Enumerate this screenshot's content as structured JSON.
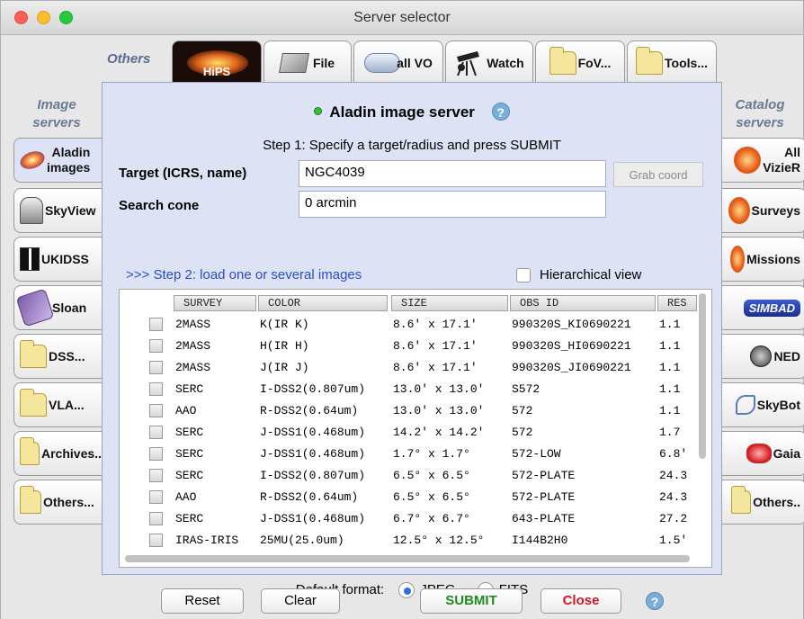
{
  "window": {
    "title": "Server selector"
  },
  "captions": {
    "top": "Others",
    "left": "Image servers",
    "right": "Catalog servers"
  },
  "top_tabs": [
    {
      "label": "HiPS",
      "icon": "hips-galaxy-icon"
    },
    {
      "label": "File",
      "icon": "disk-icon"
    },
    {
      "label": "all VO",
      "icon": "cloud-icon"
    },
    {
      "label": "Watch",
      "icon": "telescope-icon"
    },
    {
      "label": "FoV...",
      "icon": "folder-icon"
    },
    {
      "label": "Tools...",
      "icon": "folder-icon"
    }
  ],
  "left_tabs": [
    {
      "line1": "Aladin",
      "line2": "images",
      "icon": "galaxy-icon"
    },
    {
      "line1": "SkyView",
      "icon": "skyview-icon"
    },
    {
      "line1": "UKIDSS",
      "icon": "ukidss-icon"
    },
    {
      "line1": "Sloan",
      "icon": "sloan-icon"
    },
    {
      "line1": "DSS...",
      "icon": "folder-icon"
    },
    {
      "line1": "VLA...",
      "icon": "folder-icon"
    },
    {
      "line1": "Archives...",
      "icon": "folder-icon"
    },
    {
      "line1": "Others...",
      "icon": "folder-icon"
    }
  ],
  "right_tabs": [
    {
      "line1": "All",
      "line2": "VizieR",
      "icon": "vizier-icon"
    },
    {
      "line1": "Surveys",
      "icon": "surveys-icon"
    },
    {
      "line1": "Missions",
      "icon": "missions-icon"
    },
    {
      "line1": "SIMBAD",
      "icon": "simbad-logo-icon"
    },
    {
      "line1": "NED",
      "icon": "ned-logo-icon"
    },
    {
      "line1": "SkyBot",
      "icon": "skybot-icon"
    },
    {
      "line1": "Gaia",
      "icon": "gaia-icon"
    },
    {
      "line1": "Others..",
      "icon": "folder-icon"
    }
  ],
  "panel": {
    "title": "Aladin image server",
    "help": "?",
    "step1": "Step 1: Specify a target/radius and press SUBMIT",
    "target_label": "Target (ICRS, name)",
    "target_value": "NGC4039",
    "grab_label": "Grab coord",
    "cone_label": "Search cone",
    "cone_value": "0 arcmin",
    "step2": ">>> Step 2: load one or several images",
    "hierarchical_label": "Hierarchical view",
    "format_label": "Default format:",
    "format_options": [
      "JPEG",
      "FITS"
    ],
    "format_selected": "JPEG"
  },
  "table": {
    "columns": [
      "SURVEY",
      "COLOR",
      "SIZE",
      "OBS ID",
      "RES"
    ],
    "rows": [
      [
        "2MASS",
        "K(IR K)",
        "8.6' x 17.1'",
        "990320S_KI0690221",
        "1.1"
      ],
      [
        "2MASS",
        "H(IR H)",
        "8.6' x 17.1'",
        "990320S_HI0690221",
        "1.1"
      ],
      [
        "2MASS",
        "J(IR J)",
        "8.6' x 17.1'",
        "990320S_JI0690221",
        "1.1"
      ],
      [
        "SERC",
        "I-DSS2(0.807um)",
        "13.0' x 13.0'",
        "S572",
        "1.1"
      ],
      [
        "AAO",
        "R-DSS2(0.64um)",
        "13.0' x 13.0'",
        "572",
        "1.1"
      ],
      [
        "SERC",
        "J-DSS1(0.468um)",
        "14.2' x 14.2'",
        "572",
        "1.7"
      ],
      [
        "SERC",
        "J-DSS1(0.468um)",
        "1.7° x 1.7°",
        "572-LOW",
        "6.8'"
      ],
      [
        "SERC",
        "I-DSS2(0.807um)",
        "6.5° x 6.5°",
        "572-PLATE",
        "24.3"
      ],
      [
        "AAO",
        "R-DSS2(0.64um)",
        "6.5° x 6.5°",
        "572-PLATE",
        "24.3"
      ],
      [
        "SERC",
        "J-DSS1(0.468um)",
        "6.7° x 6.7°",
        "643-PLATE",
        "27.2"
      ],
      [
        "IRAS-IRIS",
        "25MU(25.0um)",
        "12.5° x 12.5°",
        "I144B2H0",
        "1.5'"
      ]
    ]
  },
  "buttons": {
    "reset": "Reset",
    "clear": "Clear",
    "submit": "SUBMIT",
    "close": "Close",
    "help": "?"
  },
  "colors": {
    "submit": "#1f8a1f",
    "close": "#d0162a",
    "step2": "#2a4cc8",
    "panel": "#dde3f5"
  }
}
